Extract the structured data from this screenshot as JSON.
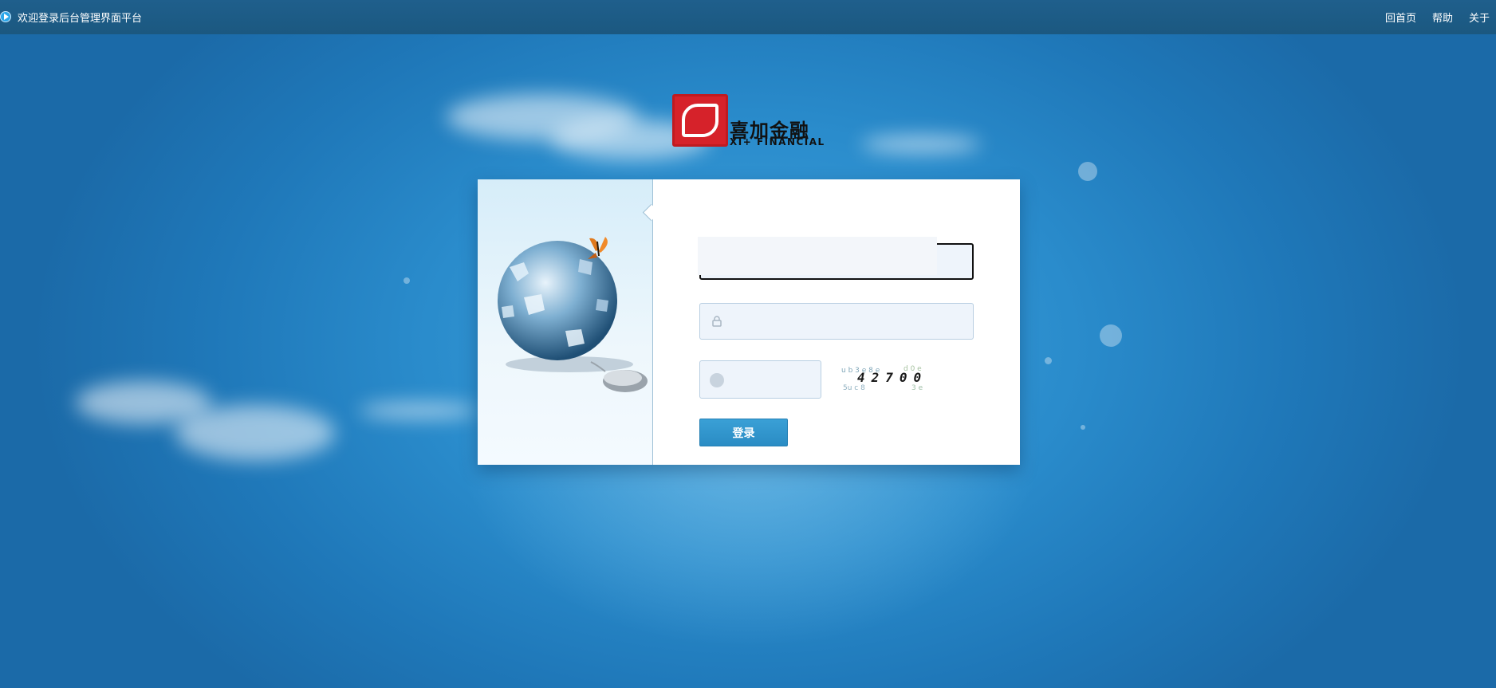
{
  "topbar": {
    "title": "欢迎登录后台管理界面平台",
    "nav": [
      "回首页",
      "帮助",
      "关于"
    ]
  },
  "logo": {
    "cn": "喜加金融",
    "en": "XI+ FINANCIAL"
  },
  "login": {
    "username_value": "",
    "password_value": "",
    "captcha_value": "",
    "captcha_text": "42700",
    "submit_label": "登录"
  },
  "colors": {
    "topbar": "#1d5b85",
    "background": "#2a8ccc",
    "button": "#3097cf",
    "field_bg": "#eef4fb"
  },
  "icons": [
    "play-icon",
    "lock-icon",
    "circle-icon",
    "globe-puzzle-icon",
    "butterfly-icon",
    "mouse-icon"
  ]
}
